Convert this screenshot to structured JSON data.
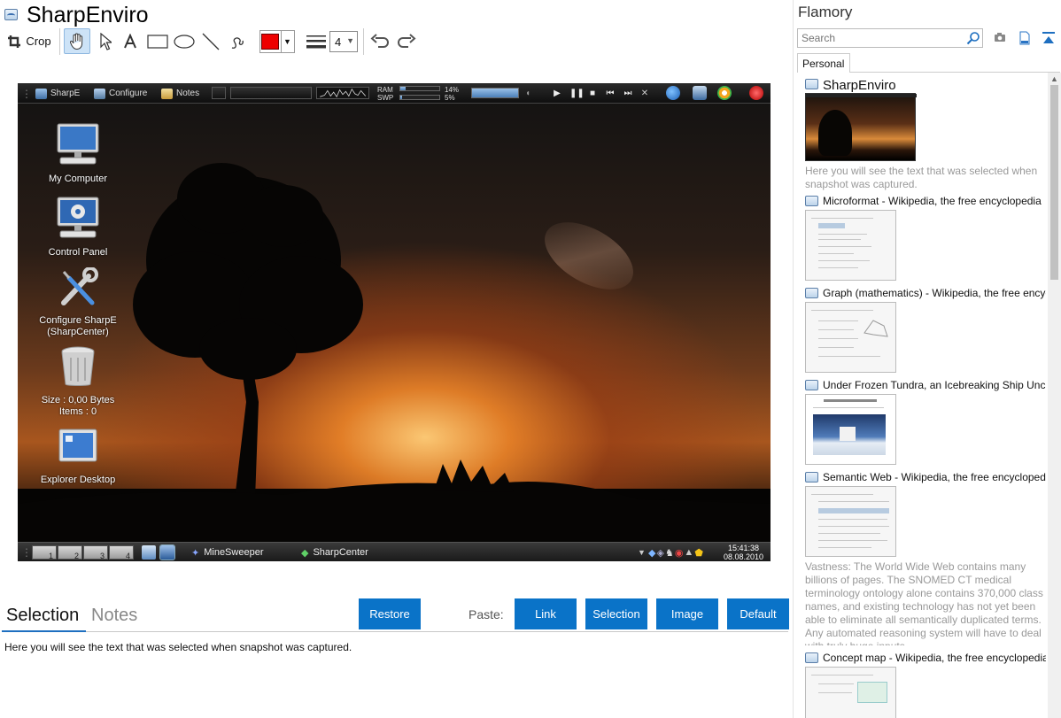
{
  "app": {
    "title": "SharpEnviro"
  },
  "toolbar": {
    "crop_label": "Crop",
    "line_width": "4",
    "color": "#ee0000"
  },
  "screenshot": {
    "top_panel": {
      "menu_label": "SharpE",
      "configure_label": "Configure",
      "notes_label": "Notes",
      "ram_label": "RAM",
      "swp_label": "SWP",
      "ram_value": "14%",
      "swp_value": "5%"
    },
    "desktop_icons": [
      {
        "label": "My Computer"
      },
      {
        "label": "Control Panel"
      },
      {
        "label": "Configure SharpE\n(SharpCenter)"
      },
      {
        "label": "Size : 0,00 Bytes\nItems : 0"
      },
      {
        "label": "Explorer Desktop"
      }
    ],
    "workspaces": [
      "1",
      "2",
      "3",
      "4"
    ],
    "tasks": [
      "MineSweeper",
      "SharpCenter"
    ],
    "clock_time": "15:41:38",
    "clock_date": "08.08.2010"
  },
  "tabs": {
    "selection": "Selection",
    "notes": "Notes"
  },
  "actions": {
    "restore": "Restore",
    "paste_label": "Paste:",
    "link": "Link",
    "selection": "Selection",
    "image": "Image",
    "default": "Default"
  },
  "selection_text": "Here you will see the text that was selected when snapshot was captured.",
  "sidebar": {
    "title": "Flamory",
    "search_placeholder": "Search",
    "tab": "Personal",
    "snapshots": [
      {
        "title": "SharpEnviro",
        "description": "Here you will see the text that was selected when snapshot was captured."
      },
      {
        "title": "Microformat - Wikipedia, the free encyclopedia"
      },
      {
        "title": "Graph (mathematics) - Wikipedia, the free encyclopedia"
      },
      {
        "title": "Under Frozen Tundra, an Icebreaking Ship Uncovers"
      },
      {
        "title": "Semantic Web - Wikipedia, the free encyclopedia",
        "description": "Vastness: The World Wide Web contains many billions of pages. The SNOMED CT medical terminology ontology alone contains 370,000 class names, and existing technology has not yet been able to eliminate all semantically duplicated terms. Any automated reasoning system will have to deal with truly huge inputs."
      },
      {
        "title": "Concept map - Wikipedia, the free encyclopedia"
      }
    ]
  }
}
